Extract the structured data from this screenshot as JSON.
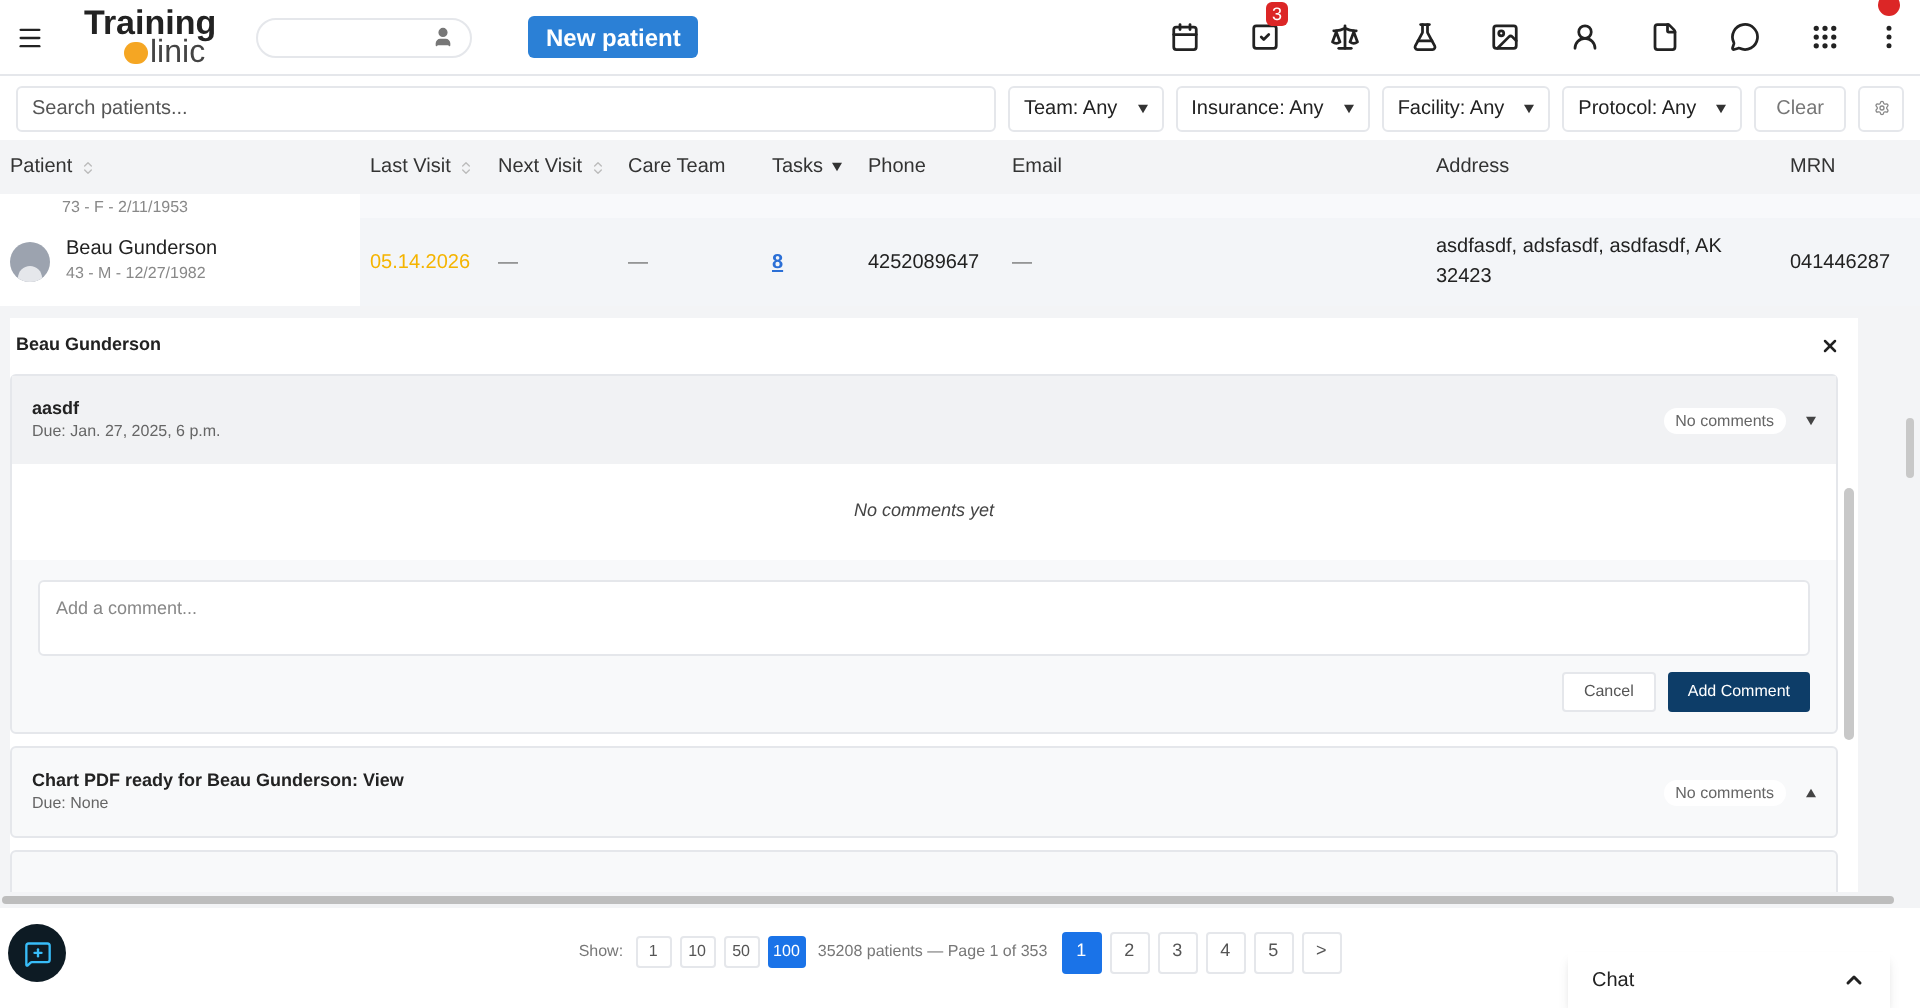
{
  "header": {
    "logo": {
      "line1": "Training",
      "line2": "linic"
    },
    "new_patient": "New patient",
    "tasks_badge": "3",
    "alert_dot": true
  },
  "filters": {
    "search_placeholder": "Search patients...",
    "dropdowns": [
      "Team: Any",
      "Insurance: Any",
      "Facility: Any",
      "Protocol: Any"
    ],
    "clear": "Clear"
  },
  "table": {
    "columns": [
      {
        "label": "Patient",
        "kind": "sortable"
      },
      {
        "label": "Last Visit",
        "kind": "sortable"
      },
      {
        "label": "Next Visit",
        "kind": "sortable"
      },
      {
        "label": "Care Team",
        "kind": "plain"
      },
      {
        "label": "Tasks",
        "kind": "sorted"
      },
      {
        "label": "Phone",
        "kind": "plain"
      },
      {
        "label": "Email",
        "kind": "plain"
      },
      {
        "label": "Address",
        "kind": "plain"
      },
      {
        "label": "MRN",
        "kind": "plain"
      }
    ],
    "rows": [
      {
        "kind": "partial",
        "subtitle": "73 - F - 2/11/1953"
      },
      {
        "kind": "full",
        "name": "Beau Gunderson",
        "subtitle": "43 - M - 12/27/1982",
        "last_visit": "05.14.2026",
        "next_visit": "—",
        "care_team": "—",
        "tasks": "8",
        "phone": "4252089647",
        "email": "—",
        "address": "asdfasdf, adsfasdf, asdfasdf, AK 32423",
        "mrn": "041446287"
      }
    ]
  },
  "panel": {
    "title": "Beau Gunderson",
    "tasks": [
      {
        "kind": "full",
        "title": "aasdf",
        "due": "Due: Jan. 27, 2025, 6 p.m.",
        "badge": "No comments",
        "expanded": true,
        "empty_text": "No comments yet",
        "placeholder": "Add a comment...",
        "cancel": "Cancel",
        "submit": "Add Comment"
      },
      {
        "kind": "full",
        "title": "Chart PDF ready for Beau Gunderson: View",
        "due": "Due: None",
        "badge": "No comments",
        "expanded": false
      },
      {
        "kind": "partial"
      }
    ]
  },
  "footer": {
    "show_label": "Show:",
    "sizes": [
      {
        "label": "1",
        "selected": false
      },
      {
        "label": "10",
        "selected": false
      },
      {
        "label": "50",
        "selected": false
      },
      {
        "label": "100",
        "selected": true
      }
    ],
    "summary": "35208 patients — Page 1 of 353",
    "pages": [
      {
        "label": "1",
        "selected": true
      },
      {
        "label": "2",
        "selected": false
      },
      {
        "label": "3",
        "selected": false
      },
      {
        "label": "4",
        "selected": false
      },
      {
        "label": "5",
        "selected": false
      }
    ],
    "next": ">"
  },
  "chat": {
    "label": "Chat"
  }
}
